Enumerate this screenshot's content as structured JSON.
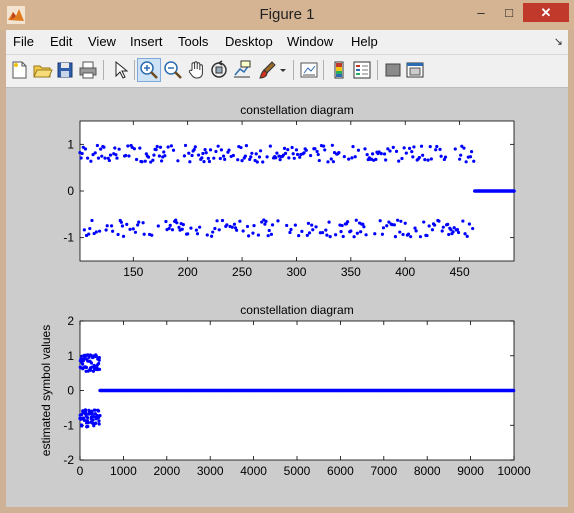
{
  "window": {
    "title": "Figure 1",
    "minimize": "–",
    "maximize": "□",
    "close": "✕"
  },
  "menu": {
    "items": [
      "File",
      "Edit",
      "View",
      "Insert",
      "Tools",
      "Desktop",
      "Window",
      "Help"
    ],
    "grip": "↘"
  },
  "toolbar": {
    "buttons": [
      "new-figure",
      "open-file",
      "save-figure",
      "print-figure",
      "edit-plot",
      "zoom-in",
      "zoom-out",
      "pan",
      "rotate-3d",
      "data-cursor",
      "brush",
      "brush-dropdown",
      "link-plot",
      "insert-colorbar",
      "insert-legend",
      "hide-plot-tools",
      "show-plot-tools"
    ],
    "active": "zoom-in"
  },
  "chart_data": [
    {
      "type": "scatter",
      "title": "constellation diagram",
      "xlabel": "",
      "ylabel": "",
      "xlim": [
        101,
        500
      ],
      "ylim": [
        -1.5,
        1.5
      ],
      "xticks": [
        150,
        200,
        250,
        300,
        350,
        400,
        450
      ],
      "yticks": [
        1,
        0,
        -1
      ],
      "marker": "dot",
      "color": "#0000ff",
      "series": [
        {
          "x_range": [
            101,
            463
          ],
          "level": 0.8,
          "spread": 0.18,
          "clusters": [
            1,
            -1
          ]
        },
        {
          "x_range": [
            464,
            500
          ],
          "level": 0,
          "spread": 0
        }
      ]
    },
    {
      "type": "scatter",
      "title": "constellation diagram",
      "xlabel": "",
      "ylabel": "estimated symbol values",
      "xlim": [
        0,
        10000
      ],
      "ylim": [
        -2,
        2
      ],
      "xticks": [
        0,
        1000,
        2000,
        3000,
        4000,
        5000,
        6000,
        7000,
        8000,
        9000,
        10000
      ],
      "yticks": [
        2,
        1,
        0,
        -1,
        -2
      ],
      "marker": "dot",
      "color": "#0000ff",
      "series": [
        {
          "x_range": [
            0,
            463
          ],
          "level": 0.8,
          "spread": 0.25,
          "clusters": [
            1,
            -1
          ]
        },
        {
          "x_range": [
            464,
            10000
          ],
          "level": 0,
          "spread": 0
        }
      ]
    }
  ]
}
